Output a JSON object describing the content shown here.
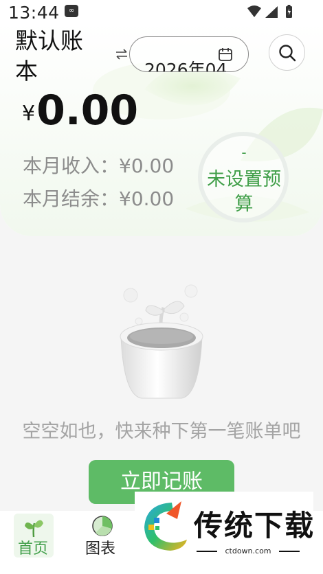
{
  "status_bar": {
    "time": "13:44",
    "notification_icon": "infinity-badge-icon",
    "icons": [
      "wifi-icon",
      "signal-icon",
      "battery-icon"
    ]
  },
  "header": {
    "book_title": "默认账本",
    "switch_icon": "swap-arrows-icon",
    "month": "2026年04",
    "calendar_icon": "calendar-icon",
    "search_icon": "search-icon"
  },
  "summary": {
    "currency_symbol": "¥",
    "balance": "0.00",
    "income_label": "本月收入：",
    "income_value": "¥0.00",
    "surplus_label": "本月结余：",
    "surplus_value": "¥0.00",
    "budget_dash": "-",
    "budget_label": "未设置预算"
  },
  "empty_state": {
    "illustration": "plant-pot-illustration",
    "message": "空空如也，快来种下第一笔账单吧",
    "record_button": "立即记账"
  },
  "bottom_nav": {
    "items": [
      {
        "label": "首页",
        "icon": "sprout-icon",
        "active": true
      },
      {
        "label": "图表",
        "icon": "pie-chart-icon",
        "active": false
      }
    ]
  },
  "watermark": {
    "title": "传统下载",
    "url": "ctdown.com"
  },
  "colors": {
    "accent_green": "#5ebb66",
    "label_green": "#3f9e48",
    "muted_text": "#8c8c8c"
  }
}
